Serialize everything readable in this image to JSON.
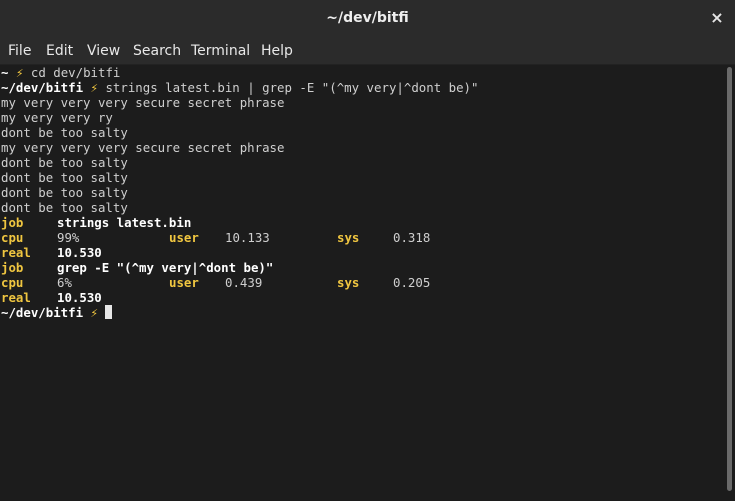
{
  "window": {
    "title": "~/dev/bitfi",
    "close_icon": "×"
  },
  "menu": [
    "File",
    "Edit",
    "View",
    "Search",
    "Terminal",
    "Help"
  ],
  "terminal": {
    "bolt_icon": "⚡",
    "lines": [
      {
        "prompt": "~",
        "command": "cd dev/bitfi"
      },
      {
        "prompt": "~/dev/bitfi",
        "command": "strings latest.bin | grep -E \"(^my very|^dont be)\""
      },
      {
        "text": "my very very very secure secret phrase"
      },
      {
        "text": "my very very ry"
      },
      {
        "text": "dont be too salty"
      },
      {
        "text": "my very very very secure secret phrase"
      },
      {
        "text": "dont be too salty"
      },
      {
        "text": "dont be too salty"
      },
      {
        "text": "dont be too salty"
      },
      {
        "text": "dont be too salty"
      }
    ],
    "timings": [
      {
        "job_label": "job",
        "job": "strings latest.bin",
        "cpu_label": "cpu",
        "cpu": "99%",
        "user_label": "user",
        "user": "10.133",
        "sys_label": "sys",
        "sys": "0.318",
        "real_label": "real",
        "real": "10.530"
      },
      {
        "job_label": "job",
        "job": "grep -E \"(^my very|^dont be)\"",
        "cpu_label": "cpu",
        "cpu": "6%",
        "user_label": "user",
        "user": "0.439",
        "sys_label": "sys",
        "sys": "0.205",
        "real_label": "real",
        "real": "10.530"
      }
    ],
    "final_prompt": "~/dev/bitfi"
  },
  "colors": {
    "background": "#1c1c1c",
    "text": "#cfcfcf",
    "accent": "#f0c640",
    "titlebar": "#2b2b2b"
  }
}
